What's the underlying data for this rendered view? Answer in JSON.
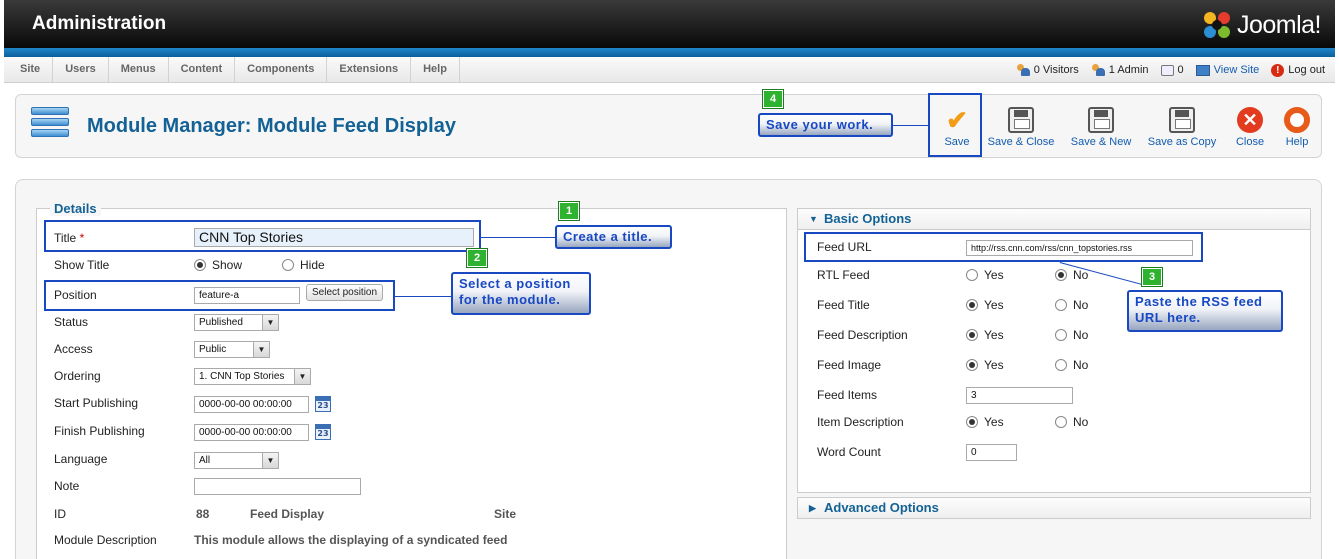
{
  "header": {
    "title": "Administration",
    "logo_text": "Joomla!"
  },
  "menu": [
    "Site",
    "Users",
    "Menus",
    "Content",
    "Components",
    "Extensions",
    "Help"
  ],
  "status": {
    "visitors": "0 Visitors",
    "admins": "1 Admin",
    "messages": "0",
    "view_site": "View Site",
    "logout": "Log out"
  },
  "page": {
    "title": "Module Manager: Module Feed Display"
  },
  "toolbar": {
    "save": "Save",
    "save_close": "Save & Close",
    "save_new": "Save & New",
    "save_copy": "Save as Copy",
    "close": "Close",
    "help": "Help"
  },
  "details": {
    "legend": "Details",
    "title_label": "Title",
    "title_required": "*",
    "title_value": "CNN Top Stories",
    "show_title_label": "Show Title",
    "show_title_show": "Show",
    "show_title_hide": "Hide",
    "position_label": "Position",
    "position_value": "feature-a",
    "select_position": "Select position",
    "status_label": "Status",
    "status_value": "Published",
    "access_label": "Access",
    "access_value": "Public",
    "ordering_label": "Ordering",
    "ordering_value": "1. CNN Top Stories",
    "start_label": "Start Publishing",
    "start_value": "0000-00-00 00:00:00",
    "finish_label": "Finish Publishing",
    "finish_value": "0000-00-00 00:00:00",
    "language_label": "Language",
    "language_value": "All",
    "note_label": "Note",
    "note_value": "",
    "id_label": "ID",
    "id_value": "88",
    "id_type": "Feed Display",
    "id_client": "Site",
    "desc_label": "Module Description",
    "desc_value": "This module allows the displaying of a syndicated feed",
    "calendar_glyph": "23"
  },
  "basic": {
    "heading": "Basic Options",
    "feed_url_label": "Feed URL",
    "feed_url_value": "http://rss.cnn.com/rss/cnn_topstories.rss",
    "rtl_label": "RTL Feed",
    "feed_title_label": "Feed Title",
    "feed_desc_label": "Feed Description",
    "feed_image_label": "Feed Image",
    "feed_items_label": "Feed Items",
    "feed_items_value": "3",
    "item_desc_label": "Item Description",
    "word_count_label": "Word Count",
    "word_count_value": "0",
    "yes": "Yes",
    "no": "No"
  },
  "advanced": {
    "heading": "Advanced Options"
  },
  "callouts": {
    "c1": "Create a title.",
    "c2_line1": "Select a position",
    "c2_line2": "for the module.",
    "c3_line1": "Paste the RSS feed",
    "c3_line2": "URL here.",
    "c4": "Save your work.",
    "n1": "1",
    "n2": "2",
    "n3": "3",
    "n4": "4"
  },
  "icons": {
    "triangle_down": "▼",
    "triangle_right": "▶",
    "check": "✔",
    "close_x": "✕",
    "logout": "!",
    "dropdown": "▼"
  }
}
